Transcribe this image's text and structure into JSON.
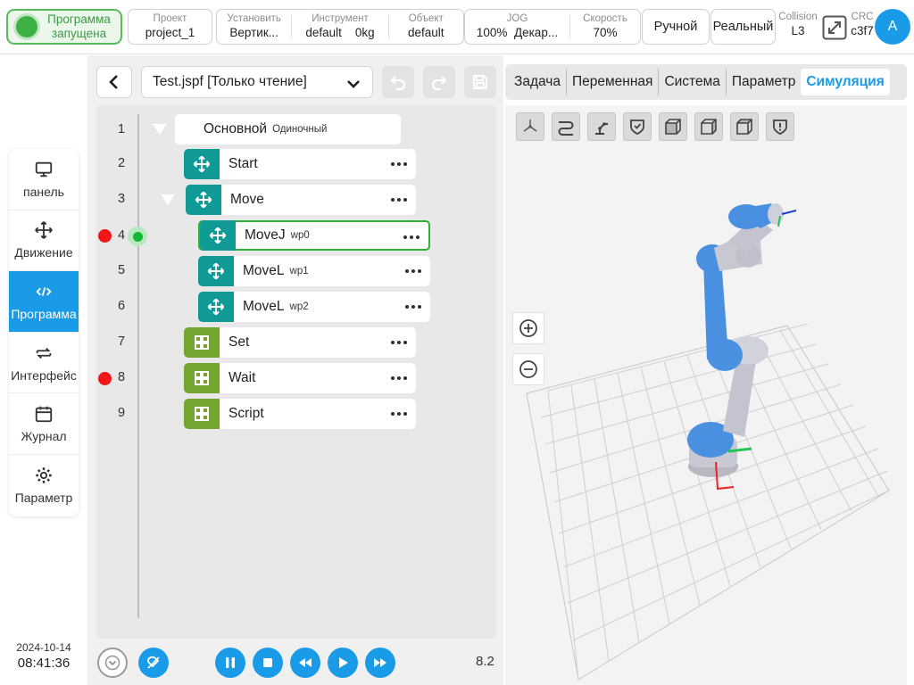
{
  "topbar": {
    "status": "Программа запущена",
    "project": {
      "label": "Проект",
      "value": "project_1"
    },
    "install": {
      "label": "Установить",
      "value": "Вертик..."
    },
    "tool": {
      "label": "Инструмент",
      "value": "default",
      "value2": "0kg"
    },
    "object": {
      "label": "Объект",
      "value": "default"
    },
    "jog": {
      "label": "JOG",
      "value": "100%",
      "value2": "Декар..."
    },
    "speed": {
      "label": "Скорость",
      "value": "70%"
    },
    "mode_manual": "Ручной",
    "mode_real": "Реальный",
    "collision": {
      "label": "Collision",
      "value": "L3"
    },
    "crc": {
      "label": "CRC",
      "value": "c3f7"
    },
    "avatar": "A"
  },
  "nav": [
    {
      "label": "панель",
      "icon": "monitor-icon"
    },
    {
      "label": "Движение",
      "icon": "move-icon"
    },
    {
      "label": "Программа",
      "icon": "code-icon"
    },
    {
      "label": "Интерфейс",
      "icon": "swap-icon"
    },
    {
      "label": "Журнал",
      "icon": "calendar-icon"
    },
    {
      "label": "Параметр",
      "icon": "gear-icon"
    }
  ],
  "datetime": {
    "date": "2024-10-14",
    "time": "08:41:36"
  },
  "editor": {
    "file": "Test.jspf [Только чтение]",
    "speed": "8.2"
  },
  "program": {
    "line_numbers": [
      "1",
      "2",
      "3",
      "4",
      "5",
      "6",
      "7",
      "8",
      "9"
    ],
    "root": {
      "name": "Основной",
      "sub": "Одиночный"
    },
    "nodes": [
      {
        "name": "Start",
        "sub": ""
      },
      {
        "name": "Move",
        "sub": ""
      },
      {
        "name": "MoveJ",
        "sub": "wp0"
      },
      {
        "name": "MoveL",
        "sub": "wp1"
      },
      {
        "name": "MoveL",
        "sub": "wp2"
      },
      {
        "name": "Set",
        "sub": ""
      },
      {
        "name": "Wait",
        "sub": ""
      },
      {
        "name": "Script",
        "sub": ""
      }
    ]
  },
  "tabs": [
    "Задача",
    "Переменная",
    "Система",
    "Параметр",
    "Симуляция"
  ],
  "colors": {
    "accent": "#1a9be8",
    "running": "#3cb043",
    "move_node": "#109a96",
    "logic_node": "#75a531",
    "breakpoint": "#f0161a",
    "robot_link": "#4a90e0"
  }
}
